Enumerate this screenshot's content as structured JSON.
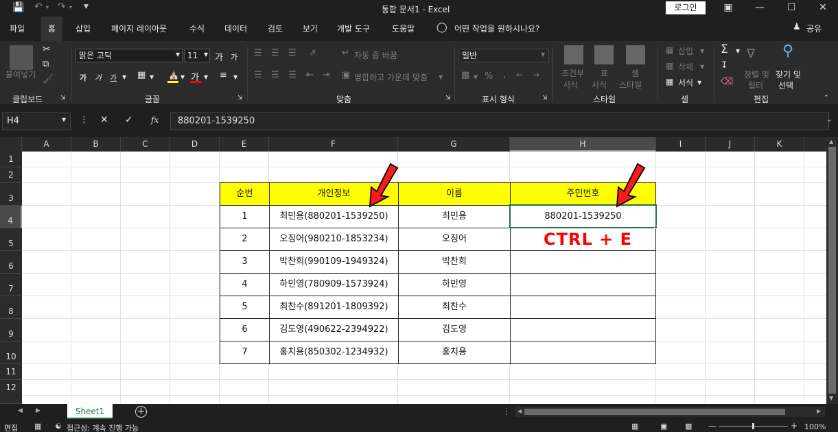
{
  "titlebar": {
    "doc_title": "통합 문서1  -  Excel",
    "login_label": "로그인",
    "customize_icon": "quick-access-dropdown"
  },
  "menu": {
    "tabs": [
      "파일",
      "홈",
      "삽입",
      "페이지 레이아웃",
      "수식",
      "데이터",
      "검토",
      "보기",
      "개발 도구",
      "도움말"
    ],
    "tell_me": "어떤 작업을 원하시나요?",
    "share": "공유"
  },
  "ribbon": {
    "clipboard": {
      "paste": "붙여넣기",
      "group": "클립보드"
    },
    "font": {
      "font_name": "맑은 고딕",
      "font_size": "11",
      "bold": "가",
      "italic": "가",
      "underline": "가",
      "grow": "가",
      "shrink": "가",
      "font_color": "가",
      "group": "글꼴"
    },
    "alignment": {
      "wrap": "자동 줄 바꿈",
      "merge": "병합하고 가운데 맞춤",
      "group": "맞춤"
    },
    "number": {
      "format": "일반",
      "percent": "%",
      "comma": ",",
      "group": "표시 형식"
    },
    "styles": {
      "cond1": "조건부",
      "cond2": "서식",
      "table1": "표",
      "table2": "서식",
      "cell1": "셀",
      "cell2": "스타일",
      "group": "스타일"
    },
    "cells": {
      "insert": "삽입",
      "delete": "삭제",
      "format": "서식",
      "group": "셀"
    },
    "editing": {
      "sum": "Σ",
      "sort1": "정렬 및",
      "sort2": "필터",
      "find1": "찾기 및",
      "find2": "선택",
      "group": "편집"
    }
  },
  "formula_bar": {
    "name_box": "H4",
    "cancel": "✕",
    "enter": "✓",
    "fx": "fx",
    "value": "880201-1539250"
  },
  "grid": {
    "columns": [
      "A",
      "B",
      "C",
      "D",
      "E",
      "F",
      "G",
      "H",
      "I",
      "J",
      "K"
    ],
    "rows": [
      "1",
      "2",
      "3",
      "4",
      "5",
      "6",
      "7",
      "8",
      "9",
      "10",
      "11",
      "12"
    ],
    "selected_col": "H",
    "selected_row": "4"
  },
  "table": {
    "headers": [
      "순번",
      "개인정보",
      "이름",
      "주민번호"
    ],
    "rows": [
      [
        "1",
        "최민용(880201-1539250)",
        "최민용",
        "880201-1539250"
      ],
      [
        "2",
        "오징어(980210-1853234)",
        "오징어",
        ""
      ],
      [
        "3",
        "박찬희(990109-1949324)",
        "박찬희",
        ""
      ],
      [
        "4",
        "하민영(780909-1573924)",
        "하민영",
        ""
      ],
      [
        "5",
        "최찬수(891201-1809392)",
        "최찬수",
        ""
      ],
      [
        "6",
        "김도영(490622-2394922)",
        "김도영",
        ""
      ],
      [
        "7",
        "홍치용(850302-1234932)",
        "홍치용",
        ""
      ]
    ]
  },
  "annotation": {
    "shortcut_text": "CTRL + E",
    "color": "#ff0000"
  },
  "sheet_tabs": {
    "active": "Sheet1",
    "add": "+"
  },
  "status": {
    "mode": "편집",
    "accessibility": "접근성: 계속 진행 가능",
    "zoom": "100%"
  }
}
